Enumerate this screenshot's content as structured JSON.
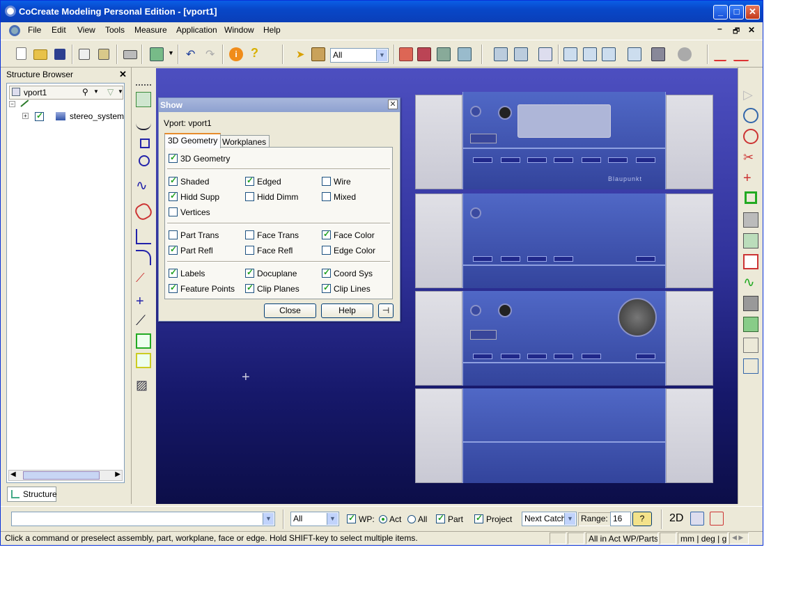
{
  "window": {
    "title": "CoCreate Modeling Personal Edition - [vport1]"
  },
  "menu": [
    "File",
    "Edit",
    "View",
    "Tools",
    "Measure",
    "Application",
    "Window",
    "Help"
  ],
  "toolbar": {
    "select_filter": "All"
  },
  "structure_browser": {
    "title": "Structure Browser",
    "viewport_name": "vport1",
    "tree_item": "stereo_system",
    "tab_label": "Structure"
  },
  "show_dialog": {
    "title": "Show",
    "vport_label": "Vport: vport1",
    "tabs": [
      "3D Geometry",
      "Workplanes"
    ],
    "master": {
      "label": "3D Geometry",
      "checked": true
    },
    "group1": [
      {
        "label": "Shaded",
        "checked": true
      },
      {
        "label": "Edged",
        "checked": true
      },
      {
        "label": "Wire",
        "checked": false
      },
      {
        "label": "Hidd Supp",
        "checked": true
      },
      {
        "label": "Hidd Dimm",
        "checked": false
      },
      {
        "label": "Mixed",
        "checked": false
      },
      {
        "label": "Vertices",
        "checked": false
      }
    ],
    "group2": [
      {
        "label": "Part Trans",
        "checked": false
      },
      {
        "label": "Face Trans",
        "checked": false
      },
      {
        "label": "Face Color",
        "checked": true
      },
      {
        "label": "Part Refl",
        "checked": true
      },
      {
        "label": "Face Refl",
        "checked": false
      },
      {
        "label": "Edge Color",
        "checked": false
      }
    ],
    "group3": [
      {
        "label": "Labels",
        "checked": true
      },
      {
        "label": "Docuplane",
        "checked": true
      },
      {
        "label": "Coord Sys",
        "checked": true
      },
      {
        "label": "Feature Points",
        "checked": true
      },
      {
        "label": "Clip Planes",
        "checked": true
      },
      {
        "label": "Clip Lines",
        "checked": true
      }
    ],
    "close_label": "Close",
    "help_label": "Help"
  },
  "bottom": {
    "command_value": "",
    "filter_value": "All",
    "wp_label": "WP:",
    "act_label": "Act",
    "all_label": "All",
    "part_label": "Part",
    "project_label": "Project",
    "catch_value": "Next Catch",
    "range_label": "Range:",
    "range_value": "16",
    "mode_2d": "2D"
  },
  "status": {
    "message": "Click a command or preselect assembly, part, workplane, face or edge. Hold SHIFT-key to select multiple items.",
    "selection_scope": "All in Act WP/Parts",
    "units": "mm | deg | g"
  },
  "model": {
    "brand_label": "Blaupunkt"
  },
  "colors": {
    "titlebar": "#0847c8",
    "viewport_top": "#4d4fc0",
    "viewport_bottom": "#0c0e48",
    "check": "#21a121"
  }
}
